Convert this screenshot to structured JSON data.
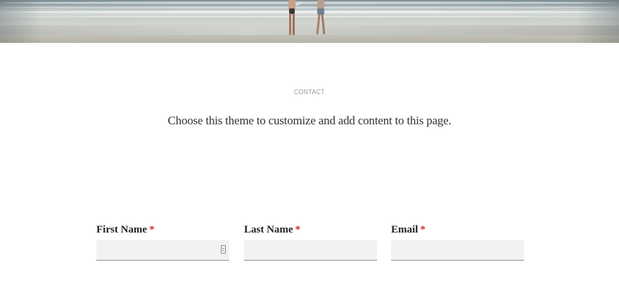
{
  "section": {
    "eyebrow": "CONTACT",
    "lead": "Choose this theme to customize and add content to this page."
  },
  "form": {
    "fields": [
      {
        "label": "First Name",
        "required_mark": "*",
        "value": ""
      },
      {
        "label": "Last Name",
        "required_mark": "*",
        "value": ""
      },
      {
        "label": "Email",
        "required_mark": "*",
        "value": ""
      }
    ]
  },
  "icons": {
    "autofill": "contact-card-autofill-icon"
  },
  "colors": {
    "required": "#d0321e",
    "input_background": "#f2f2f2",
    "lead_text": "#333333",
    "eyebrow_text": "#9a9a9a"
  }
}
